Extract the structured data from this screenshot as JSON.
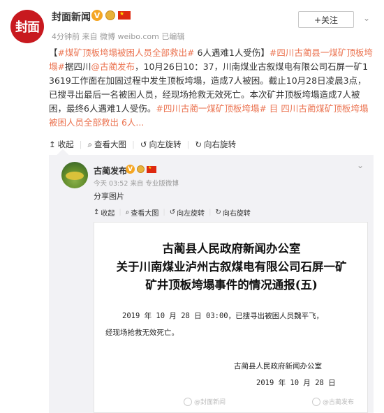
{
  "post": {
    "avatar_text": "封面",
    "user_name": "封面新闻",
    "follow_label": "+关注",
    "more_label": "⌄",
    "meta": "4分钟前 来自 微博 weibo.com  已编辑",
    "text_parts": [
      {
        "t": "【",
        "link": false
      },
      {
        "t": "#煤矿顶板垮塌被困人员全部救出#",
        "link": true
      },
      {
        "t": " 6人遇难1人受伤】",
        "link": false
      },
      {
        "t": "#四川古蔺县一煤矿顶板垮塌#",
        "link": true
      },
      {
        "t": "据四川",
        "link": false
      },
      {
        "t": "@古蔺发布",
        "link": true
      },
      {
        "t": "，10月26日10：37，川南煤业古叙煤电有限公司石屏一矿13619工作面在加固过程中发生顶板垮塌，造成7人被困。截止10月28日凌晨3点，已搜寻出最后一名被困人员，经现场抢救无效死亡。本次矿井顶板垮塌造成7人被困，最终6人遇难1人受伤。",
        "link": false
      },
      {
        "t": "#四川古蔺一煤矿顶板垮塌#",
        "link": true
      },
      {
        "t": "  ",
        "link": false
      },
      {
        "t": "目 四川古蔺煤矿顶板垮塌被困人员全部救出 6人...",
        "link": true
      }
    ]
  },
  "toolbar": {
    "collapse": "收起",
    "view_large": "查看大图",
    "rotate_left": "向左旋转",
    "rotate_right": "向右旋转"
  },
  "repost": {
    "user_name": "古蔺发布",
    "meta": "今天 03:52 来自 专业版微博",
    "text": "分享图片",
    "chevron": "⌄",
    "toolbar": {
      "collapse": "收起",
      "view_large": "查看大图",
      "rotate_left": "向左旋转",
      "rotate_right": "向右旋转"
    }
  },
  "document": {
    "title_line1": "古蔺县人民政府新闻办公室",
    "title_line2": "关于川南煤业泸州古叙煤电有限公司石屏一矿",
    "title_line3": "矿井顶板垮塌事件的情况通报(五)",
    "body_line1": "2019 年 10 月 28 日 03:00，已搜寻出被困人员魏平飞，",
    "body_line2": "经现场抢救无效死亡。",
    "signature": "古蔺县人民政府新闻办公室",
    "date": "2019 年 10 月 28 日",
    "watermark_left": "@封面新闻",
    "watermark_right": "@古蔺发布"
  },
  "colors": {
    "accent_red": "#c8191f",
    "link": "#eb7350",
    "v_badge": "#f5a623"
  }
}
